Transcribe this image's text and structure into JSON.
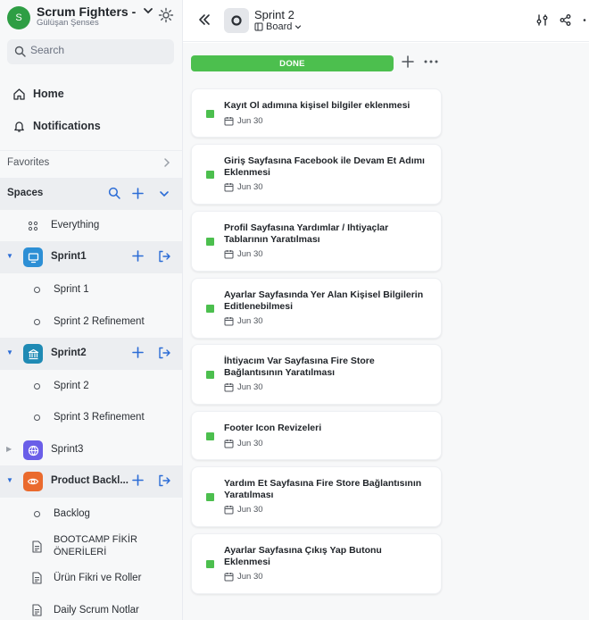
{
  "workspace": {
    "avatar_letter": "S",
    "name": "Scrum Fighters - ...",
    "user": "Gülüşan Şenses"
  },
  "search": {
    "placeholder": "Search"
  },
  "nav": {
    "home": "Home",
    "notifications": "Notifications",
    "favorites": "Favorites",
    "spaces": "Spaces"
  },
  "sidebar_rows": {
    "everything": "Everything",
    "sprint1": "Sprint1",
    "sprint1_list1": "Sprint 1",
    "sprint1_list2": "Sprint 2 Refinement",
    "sprint2": "Sprint2",
    "sprint2_list1": "Sprint 2",
    "sprint2_list2": "Sprint 3 Refinement",
    "sprint3": "Sprint3",
    "product_backlog": "Product Backl...",
    "backlog": "Backlog",
    "doc1_line1": "BOOTCAMP FİKİR",
    "doc1_line2": "ÖNERİLERİ",
    "doc2": "Ürün Fikri ve Roller",
    "doc3": "Daily Scrum Notlar"
  },
  "space_colors": {
    "sprint1": "#2d8fd5",
    "sprint2": "#1f8ab4",
    "sprint3": "#6a5ee8",
    "product_backlog": "#ea6a2d"
  },
  "header": {
    "title": "Sprint 2",
    "view": "Board"
  },
  "board": {
    "column_status": "DONE",
    "status_color": "#4cbf4e",
    "cards": [
      {
        "title": "Kayıt Ol adımına kişisel bilgiler eklenmesi",
        "date": "Jun 30"
      },
      {
        "title": "Giriş Sayfasına Facebook ile Devam Et Adımı Eklenmesi",
        "date": "Jun 30"
      },
      {
        "title": "Profil Sayfasına Yardımlar / Ihtiyaçlar Tablarının Yaratılması",
        "date": "Jun 30"
      },
      {
        "title": "Ayarlar Sayfasında Yer Alan Kişisel Bilgilerin Editlenebilmesi",
        "date": "Jun 30"
      },
      {
        "title": "İhtiyacım Var Sayfasına Fire Store Bağlantısının Yaratılması",
        "date": "Jun 30"
      },
      {
        "title": "Footer Icon Revizeleri",
        "date": "Jun 30"
      },
      {
        "title": "Yardım Et Sayfasına Fire Store Bağlantısının Yaratılması",
        "date": "Jun 30"
      },
      {
        "title": "Ayarlar Sayfasına Çıkış Yap Butonu Eklenmesi",
        "date": "Jun 30"
      }
    ]
  }
}
